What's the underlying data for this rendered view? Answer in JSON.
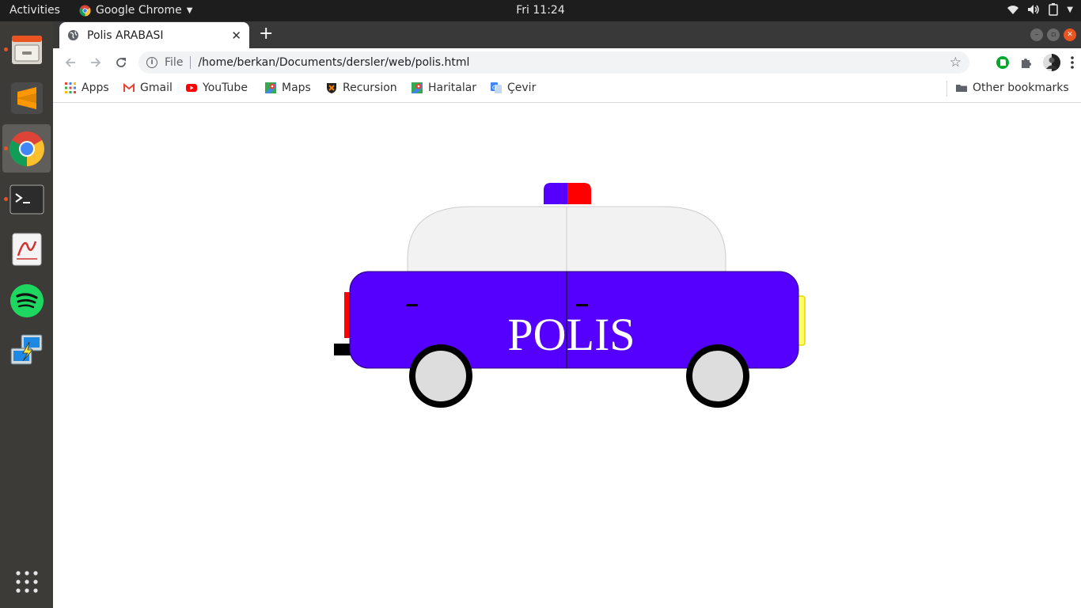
{
  "topbar": {
    "activities": "Activities",
    "app_name": "Google Chrome",
    "clock": "Fri 11:24"
  },
  "dock": {
    "items": [
      {
        "name": "Files",
        "icon": "file-cabinet-icon"
      },
      {
        "name": "Sublime Text",
        "icon": "sublime-icon"
      },
      {
        "name": "Google Chrome",
        "icon": "chrome-icon"
      },
      {
        "name": "Terminal",
        "icon": "terminal-icon"
      },
      {
        "name": "Document Viewer",
        "icon": "pdf-viewer-icon"
      },
      {
        "name": "Spotify",
        "icon": "spotify-icon"
      },
      {
        "name": "Remote Desktop",
        "icon": "remote-desktop-icon"
      }
    ],
    "show_apps": "grid-icon"
  },
  "browser": {
    "tab_title": "Polis ARABASI",
    "new_tab": "+",
    "omnibox_scheme": "File",
    "url": "/home/berkan/Documents/dersler/web/polis.html"
  },
  "bookmarks": {
    "items": [
      {
        "label": "Apps"
      },
      {
        "label": "Gmail"
      },
      {
        "label": "YouTube"
      },
      {
        "label": "Maps"
      },
      {
        "label": "Recursion"
      },
      {
        "label": "Haritalar"
      },
      {
        "label": "Çevir"
      }
    ],
    "other": "Other bookmarks"
  },
  "page": {
    "car_text": "POLIS",
    "colors": {
      "body": "#5500ff",
      "roof": "#f2f2f2",
      "siren_left": "#5500ff",
      "siren_right": "#ff0000",
      "taillight": "#ff0000",
      "headlight": "#ffff66",
      "wheel_hub": "#dddddd",
      "wheel_tire": "#000000"
    }
  }
}
